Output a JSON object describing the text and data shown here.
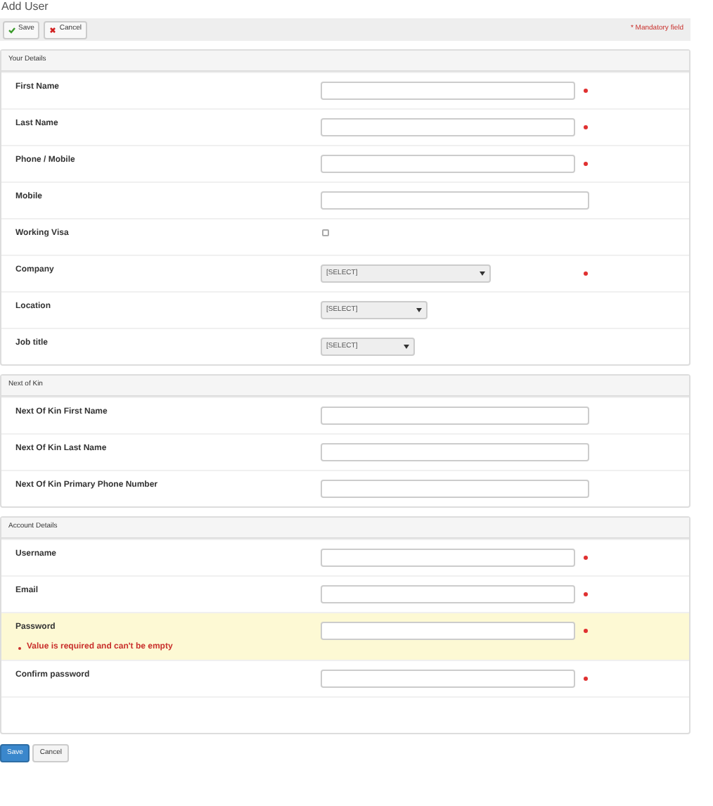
{
  "title": "Add User",
  "toolbar": {
    "buttons": [
      {
        "kind": "save",
        "label": "Save"
      },
      {
        "kind": "cancel",
        "label": "Cancel"
      }
    ],
    "mandatory_note": "* Mandatory field"
  },
  "sections": [
    {
      "title": "Your Details",
      "fields": [
        {
          "kind": "text",
          "label": "First Name",
          "required": true
        },
        {
          "kind": "text",
          "label": "Last Name",
          "required": true
        },
        {
          "kind": "text",
          "label": "Phone / Mobile",
          "required": true
        },
        {
          "kind": "text",
          "label": "Mobile",
          "required": false
        },
        {
          "kind": "checkbox",
          "label": "Working Visa",
          "required": false,
          "checked": false
        },
        {
          "kind": "select",
          "label": "Company",
          "required": true,
          "value": "[SELECT]"
        },
        {
          "kind": "select",
          "label": "Location",
          "required": false,
          "value": "[SELECT]"
        },
        {
          "kind": "select",
          "label": "Job title",
          "required": false,
          "value": "[SELECT]"
        }
      ]
    },
    {
      "title": "Next of Kin",
      "fields": [
        {
          "kind": "text",
          "label": "Next Of Kin First Name",
          "required": false
        },
        {
          "kind": "text",
          "label": "Next Of Kin Last Name",
          "required": false
        },
        {
          "kind": "text",
          "label": "Next Of Kin Primary Phone Number",
          "required": false
        }
      ]
    },
    {
      "title": "Account Details",
      "fields": [
        {
          "kind": "text",
          "label": "Username",
          "required": true
        },
        {
          "kind": "text",
          "label": "Email",
          "required": true
        },
        {
          "kind": "text",
          "label": "Password",
          "required": true,
          "error": "Value is required and can't be empty"
        },
        {
          "kind": "text",
          "label": "Confirm password",
          "required": true
        }
      ]
    }
  ],
  "footer_buttons": [
    {
      "kind": "primary",
      "label": "Save"
    },
    {
      "kind": "default",
      "label": "Cancel"
    }
  ]
}
